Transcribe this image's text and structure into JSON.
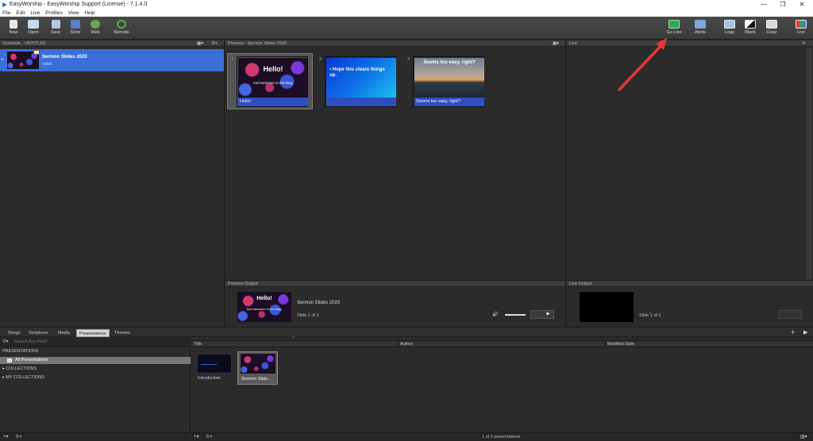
{
  "window": {
    "title": "EasyWorship - EasyWorship Support (License) - 7.1.4.0",
    "minimize": "—",
    "restore": "❐",
    "close": "✕"
  },
  "menu": [
    "File",
    "Edit",
    "Live",
    "Profiles",
    "View",
    "Help"
  ],
  "toolbar": {
    "left": [
      "New",
      "Open",
      "Save",
      "Store",
      "Web",
      "Remote"
    ],
    "right": [
      "Go Live",
      "Alerts",
      "Logo",
      "Black",
      "Clear",
      "Live"
    ]
  },
  "schedule": {
    "header": "Schedule - UNTITLED",
    "item": {
      "title": "Sermon Slides 2020",
      "subtitle": "notes"
    }
  },
  "preview": {
    "header": "Preview - Sermon Slides 2020",
    "slides": [
      {
        "num": "1",
        "title": "Hello!",
        "sub": "And welcome to the blog.",
        "caption": "Hello!"
      },
      {
        "num": "2",
        "text": "• Hope this clears things up.",
        "caption": ""
      },
      {
        "num": "3",
        "text": "Seems too easy, right?",
        "caption": "Seems too easy, right?"
      }
    ]
  },
  "live": {
    "header": "Live"
  },
  "preview_output": {
    "header": "Preview Output",
    "title": "Sermon Slides 2020",
    "slide_info": "Slide 1 of 3",
    "thumb_title": "Hello!",
    "thumb_sub": "And welcome to the blog."
  },
  "live_output": {
    "header": "Live Output",
    "slide_info": "Slide 1 of 1"
  },
  "library": {
    "tabs": [
      "Songs",
      "Scriptures",
      "Media",
      "Presentations",
      "Themes"
    ],
    "active_tab": "Presentations",
    "search_placeholder": "Search Any Field",
    "tree": {
      "root": "PRESENTATIONS",
      "all": "All Presentations",
      "collections": "COLLECTIONS",
      "my_collections": "MY COLLECTIONS"
    },
    "columns": [
      "Title",
      "Author",
      "Modified Date"
    ],
    "items": [
      {
        "label": "Introduction"
      },
      {
        "label": "Sermon Slide..."
      }
    ],
    "status": "1 of 2 presentations"
  }
}
